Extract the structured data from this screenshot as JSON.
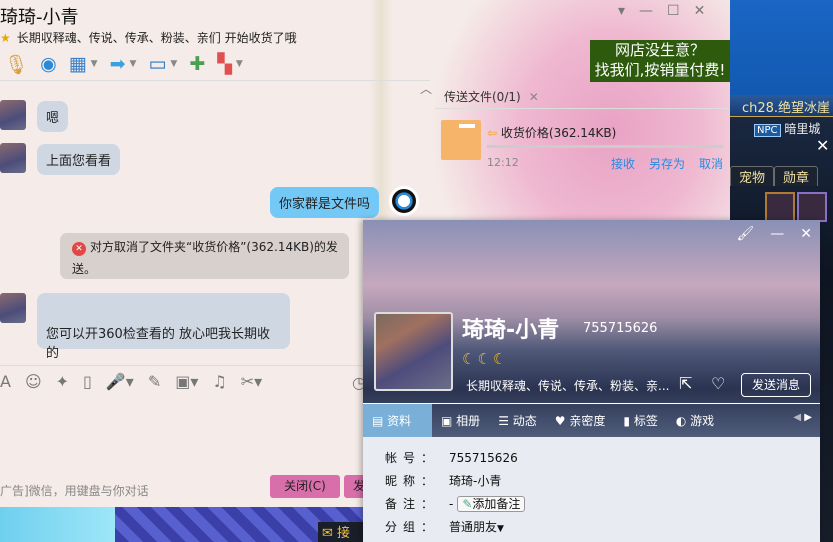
{
  "chat": {
    "title": "琦琦-小青",
    "signature": "长期収释魂、传说、传承、粉装、亲们 开始收货了哦",
    "toolbar": [
      {
        "icon": "microphone-icon"
      },
      {
        "icon": "webcam-icon"
      },
      {
        "icon": "screen-share-icon"
      },
      {
        "icon": "send-file-icon"
      },
      {
        "icon": "remote-desktop-icon"
      },
      {
        "icon": "new-chat-icon"
      },
      {
        "icon": "apps-icon"
      }
    ],
    "ad": {
      "line1": "网店没生意？",
      "line2": "找我们,按销量付费!"
    },
    "messages": [
      {
        "from": "them",
        "text": "嗯"
      },
      {
        "from": "them",
        "text": "上面您看看"
      },
      {
        "from": "me",
        "text": "你家群是文件吗"
      },
      {
        "from": "system",
        "text": "对方取消了文件夹“收货价格”(362.14KB)的发送。"
      },
      {
        "from": "them",
        "text": "您可以开360检查看的 放心吧我长期收的"
      }
    ],
    "footer_ad": "广告]微信，用键盘与你对话",
    "close_button": "关闭(C)",
    "send_button": "发"
  },
  "file_transfer": {
    "tab": "传送文件(0/1)",
    "file_name": "收货价格(362.14KB)",
    "time": "12:12",
    "progress": 0,
    "actions": [
      "接收",
      "另存为",
      "取消"
    ]
  },
  "game": {
    "location": "ch28.绝望冰崖",
    "npc": "NPC",
    "city": "暗里城",
    "tabs": [
      "宠物",
      "勋章"
    ],
    "mail": "接"
  },
  "profile": {
    "name": "琦琦-小青",
    "id": "755715626",
    "level_icons": "☾☾☾",
    "signature": "长期収释魂、传说、传承、粉装、亲...",
    "send_message": "发送消息",
    "tabs": [
      "资料",
      "相册",
      "动态",
      "亲密度",
      "标签",
      "游戏"
    ],
    "info": [
      {
        "label": "帐号：",
        "value": "755715626"
      },
      {
        "label": "昵称：",
        "value": "琦琦-小青"
      },
      {
        "label": "备注：",
        "value": "-",
        "button": "添加备注"
      },
      {
        "label": "分组：",
        "value": "普通朋友"
      }
    ]
  },
  "colors": {
    "accent": "#d86faa",
    "link": "#2b8ae0",
    "my_bubble": "#74c8f6",
    "their_bubble": "#cfd8e2",
    "active_tab": "#7ab0d8"
  }
}
